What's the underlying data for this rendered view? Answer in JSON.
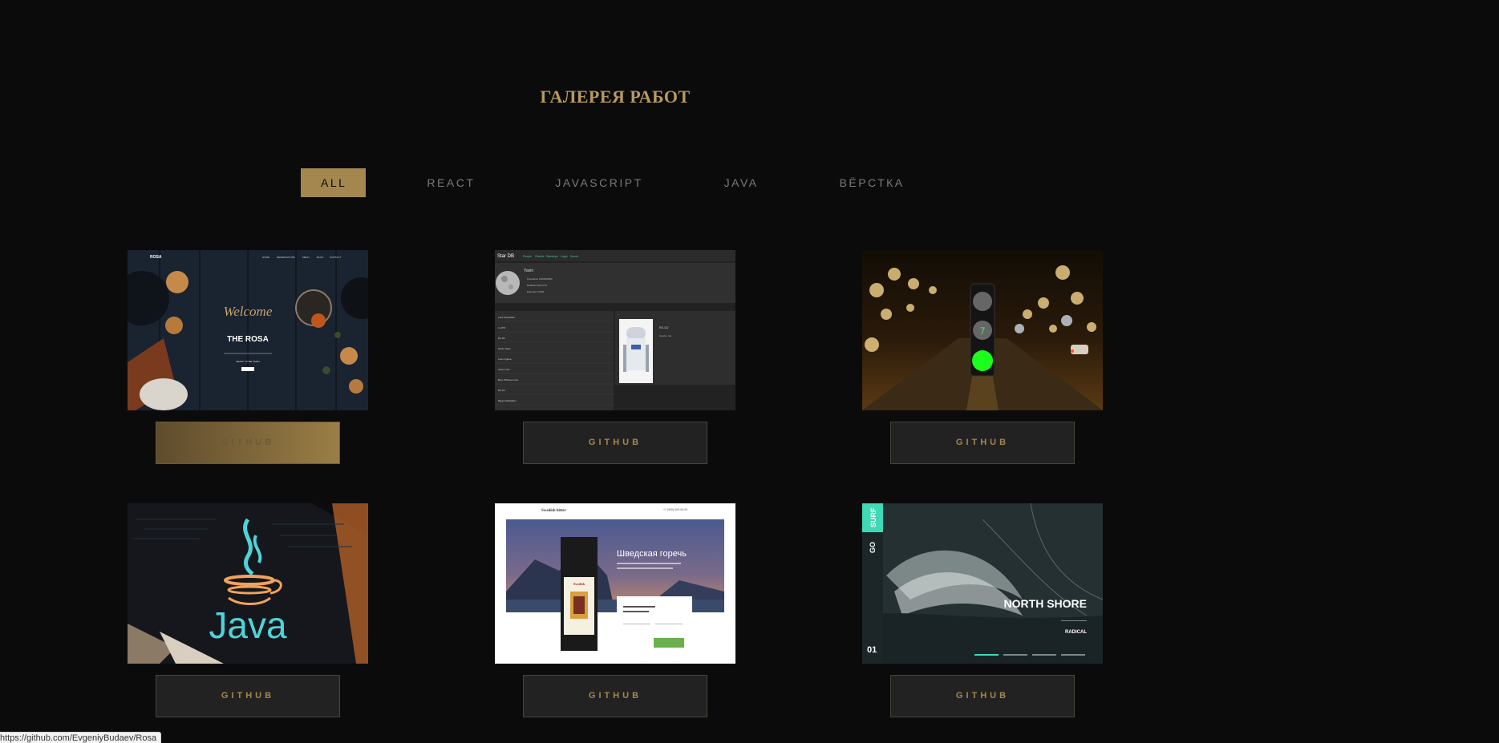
{
  "gallery": {
    "title": "ГАЛЕРЕЯ РАБОТ"
  },
  "filters": [
    {
      "label": "ALL",
      "active": true
    },
    {
      "label": "REACT",
      "active": false
    },
    {
      "label": "JAVASCRIPT",
      "active": false
    },
    {
      "label": "JAVA",
      "active": false
    },
    {
      "label": "ВЁРСТКА",
      "active": false
    }
  ],
  "projects": [
    {
      "button_label": "GITHUB",
      "hovered": true,
      "thumb": {
        "brand": "ROSA",
        "nav": [
          "HOME",
          "RESERVATIONS",
          "MENU",
          "BLOG",
          "CONTACT"
        ],
        "welcome": "Welcome",
        "heading": "THE ROSA",
        "subheading": "READY TO BE OPEN"
      }
    },
    {
      "button_label": "GITHUB",
      "hovered": false,
      "thumb": {
        "brand": "Star DB",
        "nav": [
          "People",
          "Planets",
          "Starships",
          "Login",
          "Secret"
        ],
        "planet_name": "Yavin",
        "planet_stats": [
          "Population 1000000000",
          "Rotation Period 24",
          "Diameter 10200"
        ],
        "people": [
          "Luke Skywalker",
          "C-3PO",
          "R2-D2",
          "Darth Vader",
          "Leia Organa",
          "Owen Lars",
          "Beru Whitesun lars",
          "R5-D4",
          "Biggs Darklighter"
        ],
        "droid_name": "R2-D2",
        "droid_detail": "Gender n/a"
      }
    },
    {
      "button_label": "GITHUB",
      "hovered": false,
      "thumb": {
        "counter": "7"
      }
    },
    {
      "button_label": "GITHUB",
      "hovered": false,
      "thumb": {
        "logo_text": "Java"
      }
    },
    {
      "button_label": "GITHUB",
      "hovered": false,
      "thumb": {
        "brand": "Swedish bitter",
        "phone": "+7 (999) 999-99-99",
        "heading": "Шведская горечь"
      }
    },
    {
      "button_label": "GITHUB",
      "hovered": false,
      "thumb": {
        "badge": "SURF",
        "side_text": "GO",
        "number": "01",
        "heading": "NORTH SHORE",
        "condition": "RADICAL"
      }
    }
  ],
  "status_bar": {
    "url": "https://github.com/EvgeniyBudaev/Rosa"
  },
  "colors": {
    "background": "#0b0b0b",
    "accent": "#a4874f",
    "title": "#b89a5f"
  }
}
